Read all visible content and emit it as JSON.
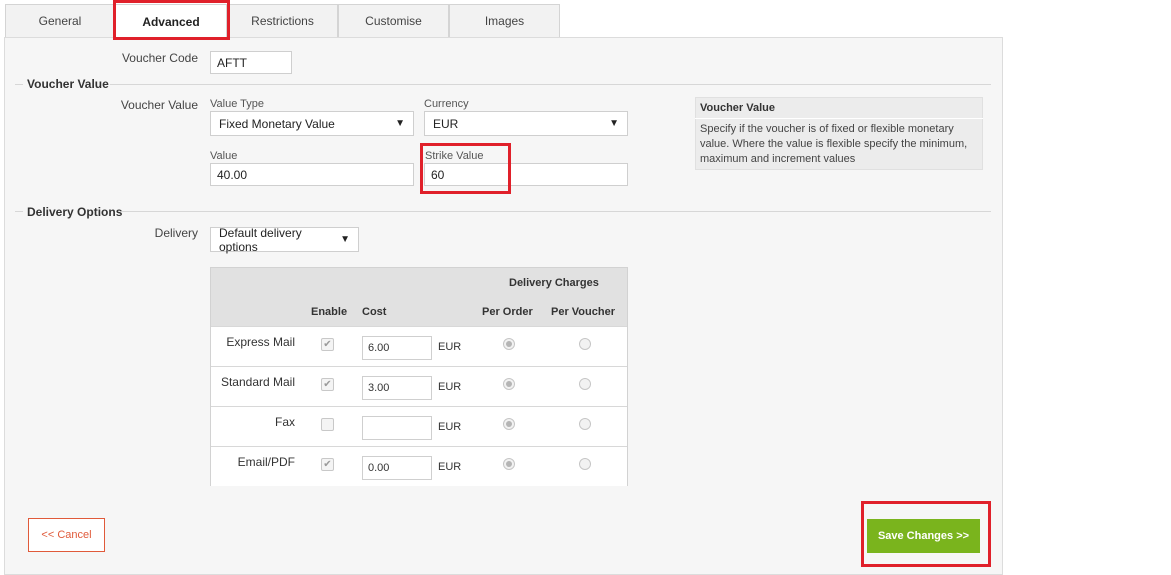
{
  "tabs": [
    "General",
    "Advanced",
    "Restrictions",
    "Customise",
    "Images"
  ],
  "voucher_code": {
    "label": "Voucher Code",
    "value": "AFTT"
  },
  "voucher_value_section": {
    "title": "Voucher Value",
    "row_label": "Voucher Value",
    "value_type": {
      "label": "Value Type",
      "selected": "Fixed Monetary Value"
    },
    "currency": {
      "label": "Currency",
      "selected": "EUR"
    },
    "value": {
      "label": "Value",
      "value": "40.00"
    },
    "strike_value": {
      "label": "Strike Value",
      "value": "60"
    }
  },
  "help": {
    "title": "Voucher Value",
    "text": "Specify if the voucher is of fixed or flexible monetary value. Where the value is flexible specify the minimum, maximum and increment values"
  },
  "delivery_section": {
    "title": "Delivery Options",
    "row_label": "Delivery",
    "delivery_select": "Default delivery options",
    "table": {
      "group_header": "Delivery Charges",
      "headers": {
        "enable": "Enable",
        "cost": "Cost",
        "per_order": "Per Order",
        "per_voucher": "Per Voucher"
      },
      "rows": [
        {
          "name": "Express Mail",
          "enabled": true,
          "cost": "6.00",
          "currency": "EUR",
          "per_order": true,
          "per_voucher": false
        },
        {
          "name": "Standard Mail",
          "enabled": true,
          "cost": "3.00",
          "currency": "EUR",
          "per_order": true,
          "per_voucher": false
        },
        {
          "name": "Fax",
          "enabled": false,
          "cost": "",
          "currency": "EUR",
          "per_order": true,
          "per_voucher": false
        },
        {
          "name": "Email/PDF",
          "enabled": true,
          "cost": "0.00",
          "currency": "EUR",
          "per_order": true,
          "per_voucher": false
        }
      ]
    }
  },
  "buttons": {
    "cancel": "<< Cancel",
    "save": "Save Changes >>"
  },
  "colors": {
    "highlight": "#e0202a",
    "save": "#7ab41d",
    "cancel": "#e05a3a"
  }
}
